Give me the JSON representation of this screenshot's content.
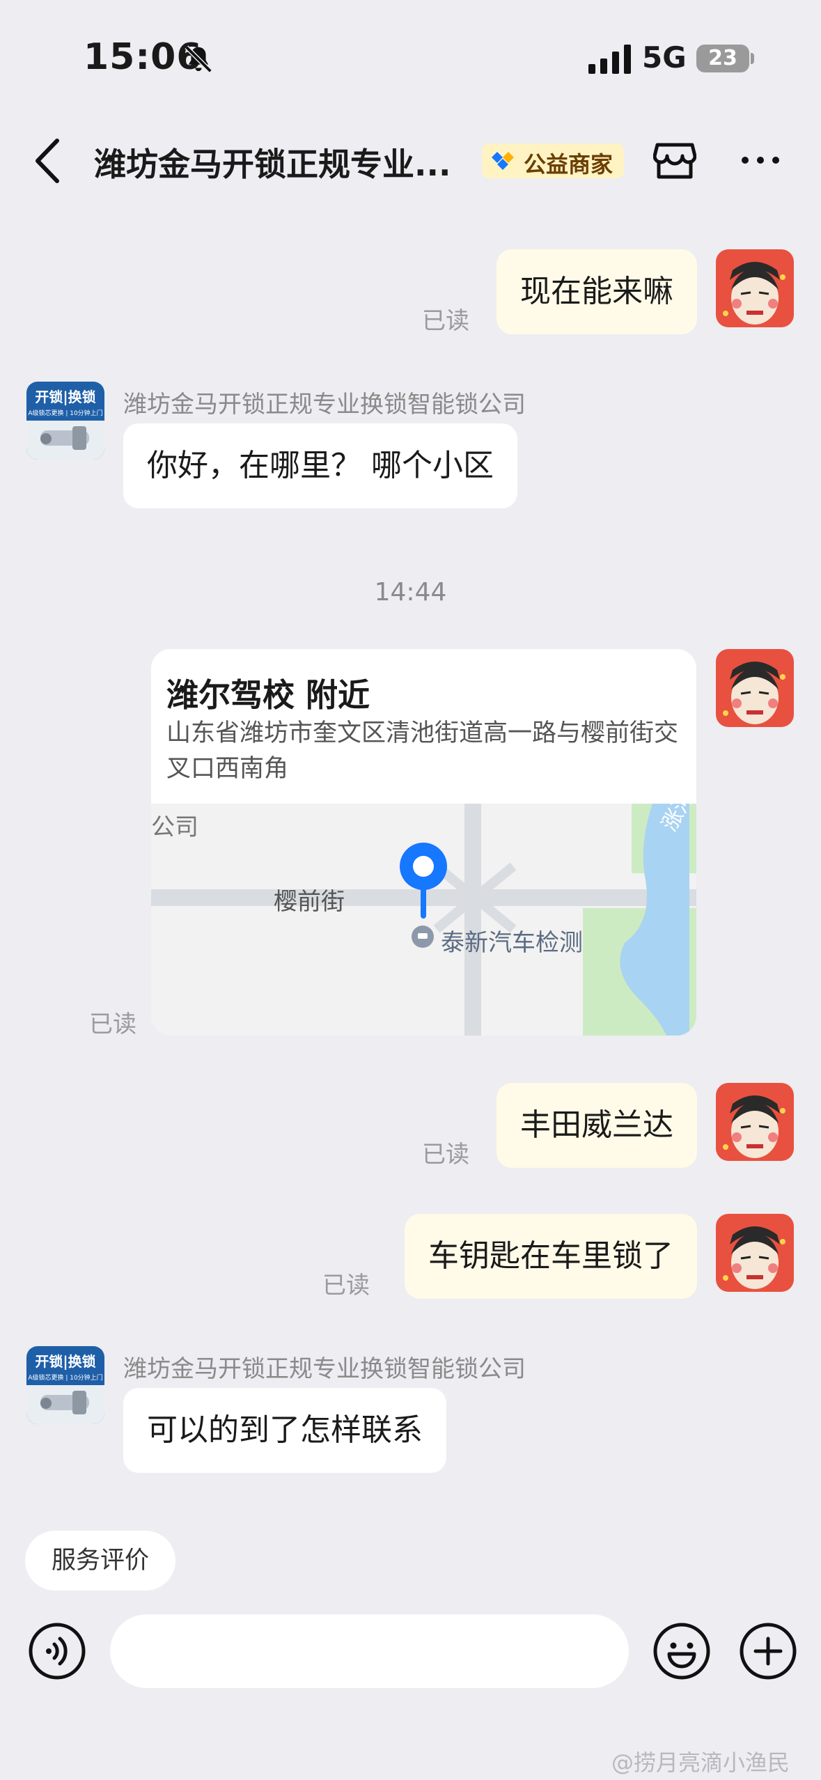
{
  "status_bar": {
    "time": "15:06",
    "network": "5G",
    "battery": "23"
  },
  "header": {
    "title": "潍坊金马开锁正规专业...",
    "badge": "公益商家"
  },
  "messages": {
    "m1": {
      "text": "现在能来嘛",
      "read": "已读"
    },
    "m2": {
      "sender": "潍坊金马开锁正规专业换锁智能锁公司",
      "text": "你好，在哪里？ 哪个小区"
    },
    "time_divider": "14:44",
    "m3": {
      "title": "潍尔驾校 附近",
      "address": "山东省潍坊市奎文区清池街道高一路与樱前街交叉口西南角",
      "map": {
        "street": "樱前街",
        "poi": "泰新汽车检测",
        "river": "涨河",
        "corner": "公司"
      },
      "read": "已读"
    },
    "m4": {
      "text": "丰田威兰达",
      "read": "已读"
    },
    "m5": {
      "text": "车钥匙在车里锁了",
      "read": "已读"
    },
    "m6": {
      "sender": "潍坊金马开锁正规专业换锁智能锁公司",
      "text": "可以的到了怎样联系"
    }
  },
  "shop_avatar": {
    "line1": "开锁",
    "line2": "换锁",
    "small": "A级锁芯更换 | 10分钟上门"
  },
  "bottom": {
    "service_label": "服务评价",
    "input_placeholder": ""
  },
  "watermark": "@捞月亮滴小渔民",
  "colors": {
    "accent": "#1677FF",
    "my_bubble": "#FFFBE8",
    "background": "#EDEDF2",
    "badge_bg": "#FFF3C4"
  }
}
